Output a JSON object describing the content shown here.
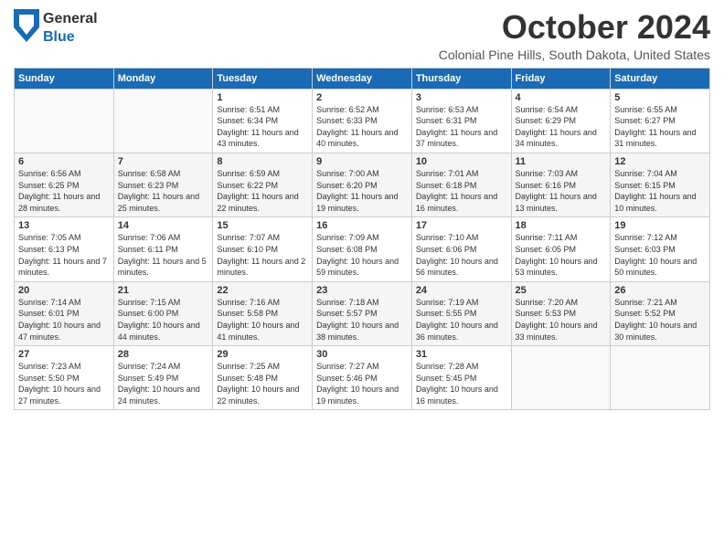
{
  "header": {
    "logo_line1": "General",
    "logo_line2": "Blue",
    "title": "October 2024",
    "subtitle": "Colonial Pine Hills, South Dakota, United States"
  },
  "days_of_week": [
    "Sunday",
    "Monday",
    "Tuesday",
    "Wednesday",
    "Thursday",
    "Friday",
    "Saturday"
  ],
  "weeks": [
    [
      {
        "day": "",
        "info": ""
      },
      {
        "day": "",
        "info": ""
      },
      {
        "day": "1",
        "info": "Sunrise: 6:51 AM\nSunset: 6:34 PM\nDaylight: 11 hours and 43 minutes."
      },
      {
        "day": "2",
        "info": "Sunrise: 6:52 AM\nSunset: 6:33 PM\nDaylight: 11 hours and 40 minutes."
      },
      {
        "day": "3",
        "info": "Sunrise: 6:53 AM\nSunset: 6:31 PM\nDaylight: 11 hours and 37 minutes."
      },
      {
        "day": "4",
        "info": "Sunrise: 6:54 AM\nSunset: 6:29 PM\nDaylight: 11 hours and 34 minutes."
      },
      {
        "day": "5",
        "info": "Sunrise: 6:55 AM\nSunset: 6:27 PM\nDaylight: 11 hours and 31 minutes."
      }
    ],
    [
      {
        "day": "6",
        "info": "Sunrise: 6:56 AM\nSunset: 6:25 PM\nDaylight: 11 hours and 28 minutes."
      },
      {
        "day": "7",
        "info": "Sunrise: 6:58 AM\nSunset: 6:23 PM\nDaylight: 11 hours and 25 minutes."
      },
      {
        "day": "8",
        "info": "Sunrise: 6:59 AM\nSunset: 6:22 PM\nDaylight: 11 hours and 22 minutes."
      },
      {
        "day": "9",
        "info": "Sunrise: 7:00 AM\nSunset: 6:20 PM\nDaylight: 11 hours and 19 minutes."
      },
      {
        "day": "10",
        "info": "Sunrise: 7:01 AM\nSunset: 6:18 PM\nDaylight: 11 hours and 16 minutes."
      },
      {
        "day": "11",
        "info": "Sunrise: 7:03 AM\nSunset: 6:16 PM\nDaylight: 11 hours and 13 minutes."
      },
      {
        "day": "12",
        "info": "Sunrise: 7:04 AM\nSunset: 6:15 PM\nDaylight: 11 hours and 10 minutes."
      }
    ],
    [
      {
        "day": "13",
        "info": "Sunrise: 7:05 AM\nSunset: 6:13 PM\nDaylight: 11 hours and 7 minutes."
      },
      {
        "day": "14",
        "info": "Sunrise: 7:06 AM\nSunset: 6:11 PM\nDaylight: 11 hours and 5 minutes."
      },
      {
        "day": "15",
        "info": "Sunrise: 7:07 AM\nSunset: 6:10 PM\nDaylight: 11 hours and 2 minutes."
      },
      {
        "day": "16",
        "info": "Sunrise: 7:09 AM\nSunset: 6:08 PM\nDaylight: 10 hours and 59 minutes."
      },
      {
        "day": "17",
        "info": "Sunrise: 7:10 AM\nSunset: 6:06 PM\nDaylight: 10 hours and 56 minutes."
      },
      {
        "day": "18",
        "info": "Sunrise: 7:11 AM\nSunset: 6:05 PM\nDaylight: 10 hours and 53 minutes."
      },
      {
        "day": "19",
        "info": "Sunrise: 7:12 AM\nSunset: 6:03 PM\nDaylight: 10 hours and 50 minutes."
      }
    ],
    [
      {
        "day": "20",
        "info": "Sunrise: 7:14 AM\nSunset: 6:01 PM\nDaylight: 10 hours and 47 minutes."
      },
      {
        "day": "21",
        "info": "Sunrise: 7:15 AM\nSunset: 6:00 PM\nDaylight: 10 hours and 44 minutes."
      },
      {
        "day": "22",
        "info": "Sunrise: 7:16 AM\nSunset: 5:58 PM\nDaylight: 10 hours and 41 minutes."
      },
      {
        "day": "23",
        "info": "Sunrise: 7:18 AM\nSunset: 5:57 PM\nDaylight: 10 hours and 38 minutes."
      },
      {
        "day": "24",
        "info": "Sunrise: 7:19 AM\nSunset: 5:55 PM\nDaylight: 10 hours and 36 minutes."
      },
      {
        "day": "25",
        "info": "Sunrise: 7:20 AM\nSunset: 5:53 PM\nDaylight: 10 hours and 33 minutes."
      },
      {
        "day": "26",
        "info": "Sunrise: 7:21 AM\nSunset: 5:52 PM\nDaylight: 10 hours and 30 minutes."
      }
    ],
    [
      {
        "day": "27",
        "info": "Sunrise: 7:23 AM\nSunset: 5:50 PM\nDaylight: 10 hours and 27 minutes."
      },
      {
        "day": "28",
        "info": "Sunrise: 7:24 AM\nSunset: 5:49 PM\nDaylight: 10 hours and 24 minutes."
      },
      {
        "day": "29",
        "info": "Sunrise: 7:25 AM\nSunset: 5:48 PM\nDaylight: 10 hours and 22 minutes."
      },
      {
        "day": "30",
        "info": "Sunrise: 7:27 AM\nSunset: 5:46 PM\nDaylight: 10 hours and 19 minutes."
      },
      {
        "day": "31",
        "info": "Sunrise: 7:28 AM\nSunset: 5:45 PM\nDaylight: 10 hours and 16 minutes."
      },
      {
        "day": "",
        "info": ""
      },
      {
        "day": "",
        "info": ""
      }
    ]
  ]
}
